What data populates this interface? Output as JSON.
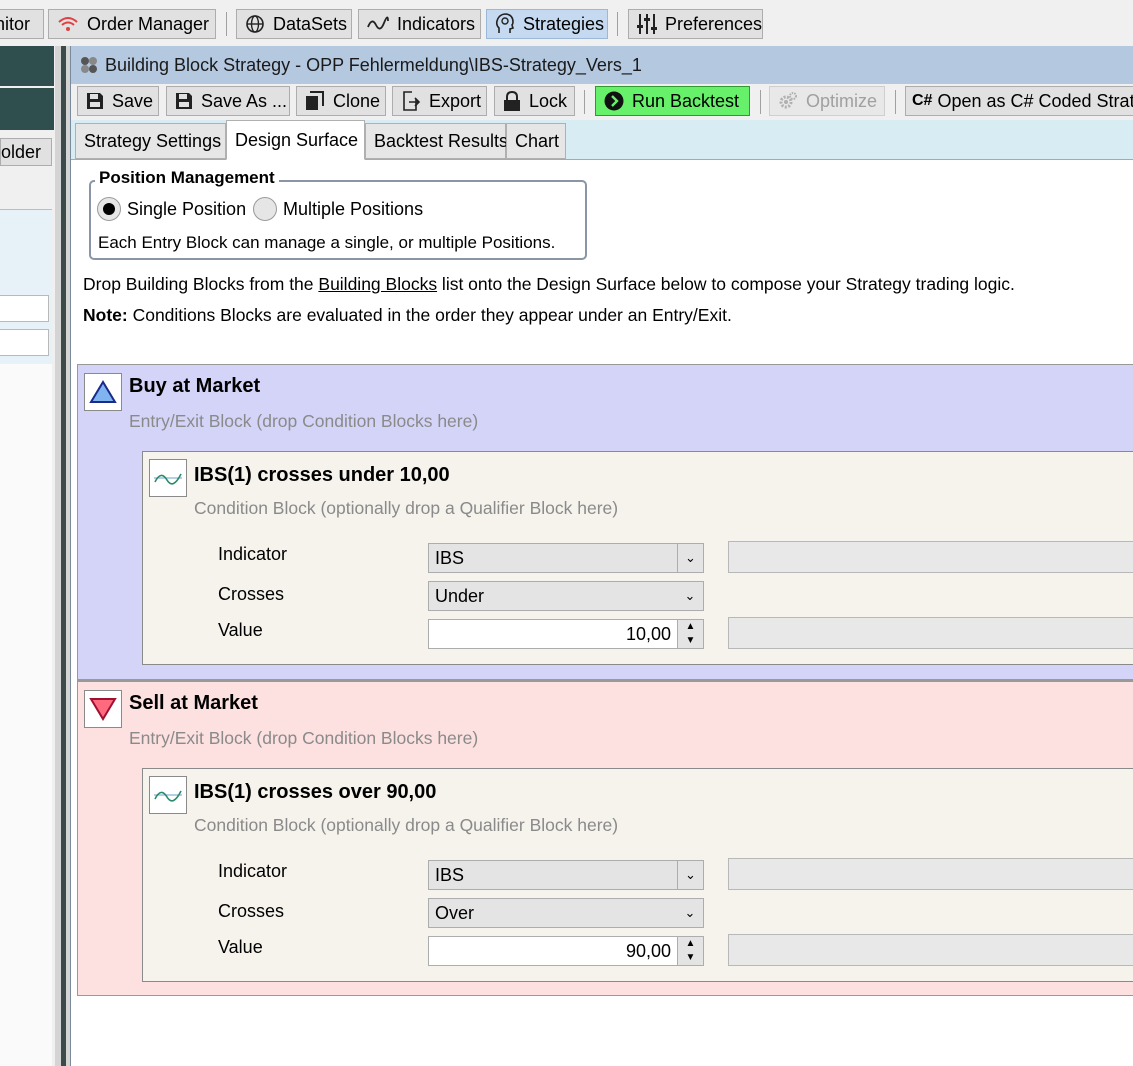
{
  "main_toolbar": {
    "monitor_label": "nitor",
    "order_manager_label": "Order Manager",
    "datasets_label": "DataSets",
    "indicators_label": "Indicators",
    "strategies_label": "Strategies",
    "preferences_label": "Preferences"
  },
  "left_panel": {
    "folder_button_label": "older"
  },
  "window": {
    "title": "Building Block Strategy - OPP Fehlermeldung\\IBS-Strategy_Vers_1"
  },
  "toolbar": {
    "save_label": "Save",
    "save_as_label": "Save As ...",
    "clone_label": "Clone",
    "export_label": "Export",
    "lock_label": "Lock",
    "run_backtest_label": "Run Backtest",
    "optimize_label": "Optimize",
    "open_csharp_label": "Open as C# Coded Strate"
  },
  "tabs": [
    {
      "label": "Strategy Settings"
    },
    {
      "label": "Design Surface"
    },
    {
      "label": "Backtest Results"
    },
    {
      "label": "Chart"
    }
  ],
  "position_management": {
    "title": "Position Management",
    "single_label": "Single Position",
    "multiple_label": "Multiple Positions",
    "selected": "single",
    "description": "Each Entry Block can manage a single, or multiple Positions."
  },
  "instructions": {
    "line1_prefix": "Drop Building Blocks from the ",
    "line1_link": "Building Blocks",
    "line1_suffix": " list onto the Design Surface below to compose your Strategy trading logic.",
    "note_label": "Note:",
    "note_text": " Conditions Blocks are evaluated in the order they appear under an Entry/Exit."
  },
  "blocks": [
    {
      "title": "Buy at Market",
      "subtitle": "Entry/Exit Block (drop Condition Blocks here)",
      "icon": "triangle-up-icon",
      "color": "#d4d4f8",
      "condition": {
        "title": "IBS(1) crosses under 10,00",
        "subtitle": "Condition Block (optionally drop a Qualifier Block here)",
        "indicator_label": "Indicator",
        "indicator_value": "IBS",
        "crosses_label": "Crosses",
        "crosses_value": "Under",
        "value_label": "Value",
        "value": "10,00"
      }
    },
    {
      "title": "Sell at Market",
      "subtitle": "Entry/Exit Block (drop Condition Blocks here)",
      "icon": "triangle-down-icon",
      "color": "#fde0e0",
      "condition": {
        "title": "IBS(1) crosses over 90,00",
        "subtitle": "Condition Block (optionally drop a Qualifier Block here)",
        "indicator_label": "Indicator",
        "indicator_value": "IBS",
        "crosses_label": "Crosses",
        "crosses_value": "Over",
        "value_label": "Value",
        "value": "90,00"
      }
    }
  ],
  "colors": {
    "run_backtest": "#67f06a",
    "strategies_active": "#c5daf0",
    "title_bar": "#b4c8e0"
  }
}
